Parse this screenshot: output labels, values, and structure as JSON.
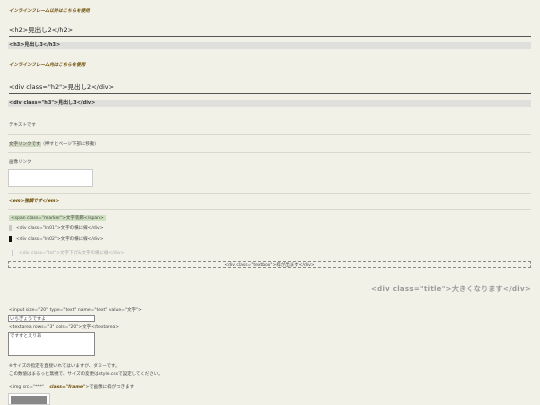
{
  "inline_frame_note": "インラインフレーム以外はこちらを使用",
  "h2_sample": "<h2>見出し2</h2>",
  "h3_sample": "<h3>見出し3</h3>",
  "inline_frame_inner_note": "インラインフレーム内はこちらを使用",
  "div_h2_sample": "<div class=\"h2\">見出し2</div>",
  "div_h3_sample": "<div class=\"h3\">見出し3</div>",
  "text_sample": "テキストです",
  "link": {
    "text": "文字リンクです",
    "suffix": "（押すとページ下部に移動）"
  },
  "image_link_label": "画像リンク",
  "em_sample": "<em>強調です</em>",
  "marker_sample": "<span class=\"marker\">文字装飾</span>",
  "ln01_sample": "<div class=\"ln01\">文字の横に線</div>",
  "ln02_sample": "<div class=\"ln02\">文字の横に線</div>",
  "txt_sample": "<div class=\"txt\">文字下げ&文字の横に線</div>",
  "textbox_sample": "<div class=\"textbox\">枠が出ます</div>",
  "title_sample": "<div class=\"title\">大きくなります</div>",
  "input_code": "<input size=\"20\" type=\"text\" name=\"text\" value=\"文字\">",
  "input_value": "いちぎょうですよ",
  "textarea_code": "<textarea rows=\"3\" cols=\"20\">文字</textarea>",
  "textarea_value": "ですすとえりあ",
  "size_note_1": "※サイズの指定を直接いれてはいますが、ダミーです。",
  "size_note_2": "この数値はまるっと無視で、サイズの変更はstyle.cssで設定してください。",
  "img_code_prefix": "<img src=\"***\"",
  "img_code_class": "class=\"frame\"",
  "img_code_suffix": ">で画像に枠がつきます"
}
